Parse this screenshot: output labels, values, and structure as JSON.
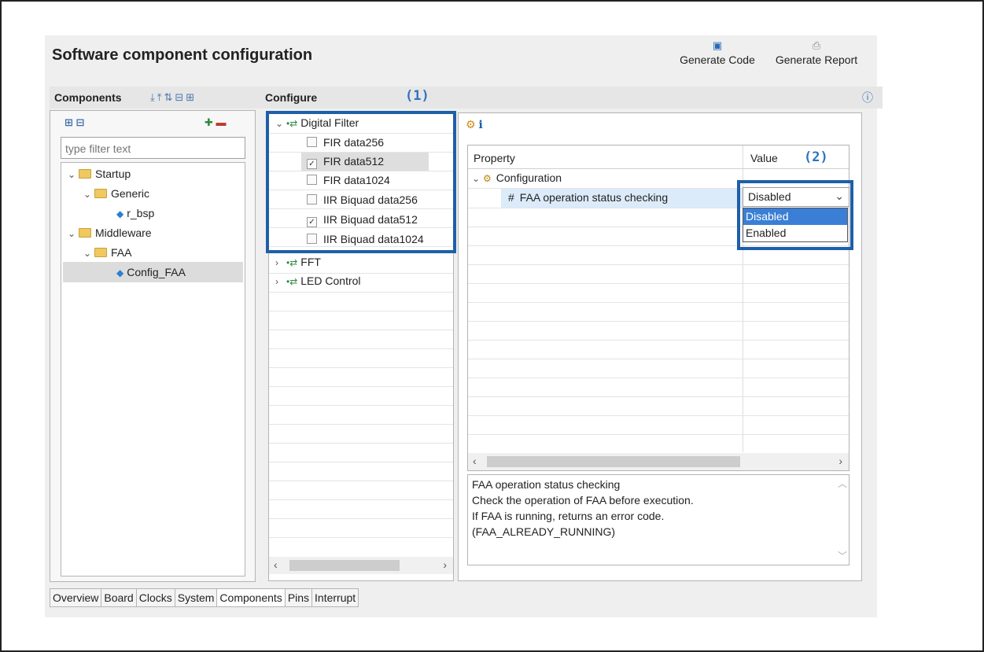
{
  "title": "Software component configuration",
  "toolbar": {
    "generate_code": "Generate Code",
    "generate_report": "Generate Report"
  },
  "components": {
    "header": "Components",
    "filter_placeholder": "type filter text",
    "tree": [
      {
        "label": "Startup",
        "level": 0,
        "kind": "folder",
        "expanded": true
      },
      {
        "label": "Generic",
        "level": 1,
        "kind": "folder",
        "expanded": true
      },
      {
        "label": "r_bsp",
        "level": 2,
        "kind": "component"
      },
      {
        "label": "Middleware",
        "level": 0,
        "kind": "folder",
        "expanded": true
      },
      {
        "label": "FAA",
        "level": 1,
        "kind": "folder",
        "expanded": true
      },
      {
        "label": "Config_FAA",
        "level": 2,
        "kind": "component",
        "selected": true
      }
    ]
  },
  "configure": {
    "header": "Configure",
    "digital_filter": "Digital Filter",
    "items": [
      {
        "label": "FIR data256",
        "checked": false
      },
      {
        "label": "FIR data512",
        "checked": true
      },
      {
        "label": "FIR data1024",
        "checked": false
      },
      {
        "label": "IIR Biquad data256",
        "checked": false
      },
      {
        "label": "IIR Biquad data512",
        "checked": true
      },
      {
        "label": "IIR Biquad data1024",
        "checked": false
      }
    ],
    "fft": "FFT",
    "led_control": "LED Control"
  },
  "properties": {
    "col_property": "Property",
    "col_value": "Value",
    "configuration": "Configuration",
    "prop_name": "FAA operation status checking",
    "prop_value": "Disabled",
    "options": [
      "Disabled",
      "Enabled"
    ],
    "description": [
      "FAA operation status checking",
      "Check the operation of FAA before execution.",
      "If FAA is running, returns an error code.",
      "(FAA_ALREADY_RUNNING)"
    ]
  },
  "annotations": {
    "one": "(1)",
    "two": "(2)"
  },
  "bottom_tabs": [
    "Overview",
    "Board",
    "Clocks",
    "System",
    "Components",
    "Pins",
    "Interrupt"
  ],
  "active_tab": "Components",
  "colors": {
    "highlight": "#1f5fa8",
    "annotation": "#2e73c2",
    "dropdown_selected": "#3a7fd5"
  }
}
